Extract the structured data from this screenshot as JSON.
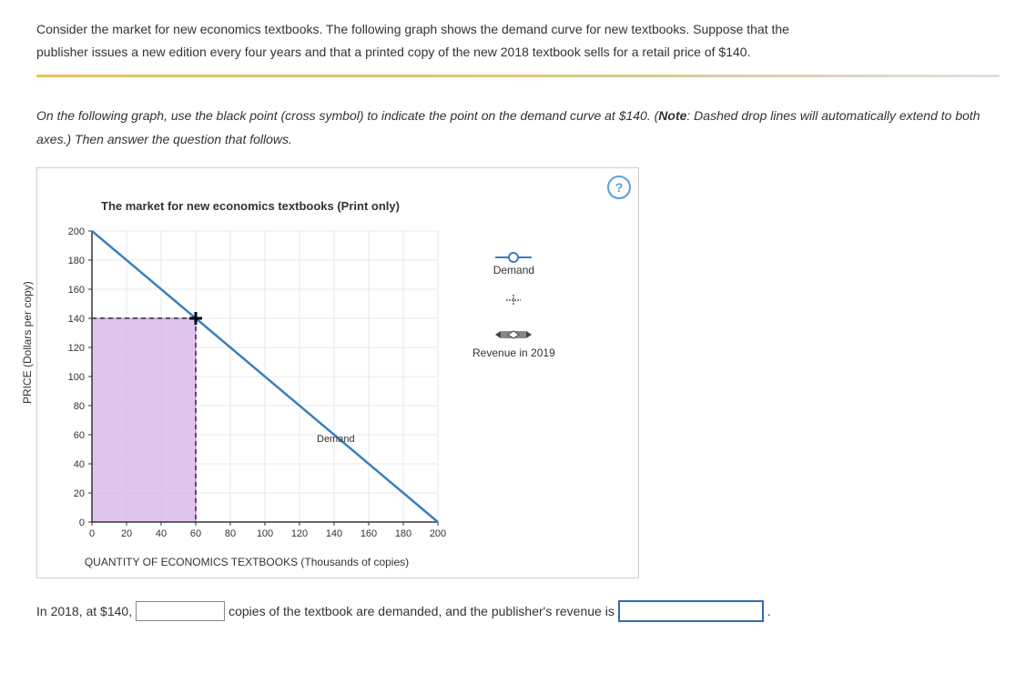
{
  "intro": {
    "line1": "Consider the market for new economics textbooks. The following graph shows the demand curve for new textbooks. Suppose that the",
    "line2": "publisher issues a new edition every four years and that a printed copy of the new 2018 textbook sells for a retail price of $140."
  },
  "instructions": {
    "pre": "On the following graph, use the black point (cross symbol) to indicate the point on the demand curve at $140. (",
    "note_label": "Note",
    "post": ": Dashed drop lines will automatically extend to both axes.) Then answer the question that follows."
  },
  "help": "?",
  "chart_title": "The market for new economics textbooks (Print only)",
  "legend": {
    "demand": "Demand",
    "revenue": "Revenue in 2019"
  },
  "answer": {
    "prefix": "In 2018, at $140,",
    "middle": "copies of the textbook are demanded, and the publisher's revenue is",
    "suffix": "."
  },
  "chart_data": {
    "type": "line",
    "title": "The market for new economics textbooks (Print only)",
    "xlabel": "QUANTITY OF ECONOMICS TEXTBOOKS (Thousands of copies)",
    "ylabel": "PRICE (Dollars per copy)",
    "xlim": [
      0,
      200
    ],
    "ylim": [
      0,
      200
    ],
    "xticks": [
      0,
      20,
      40,
      60,
      80,
      100,
      120,
      140,
      160,
      180,
      200
    ],
    "yticks": [
      0,
      20,
      40,
      60,
      80,
      100,
      120,
      140,
      160,
      180,
      200
    ],
    "series": [
      {
        "name": "Demand",
        "x": [
          0,
          200
        ],
        "y": [
          200,
          0
        ],
        "color": "#3a7fbf"
      }
    ],
    "point": {
      "x": 60,
      "y": 140,
      "symbol": "cross",
      "drop_lines": true
    },
    "shaded_region": {
      "x": [
        0,
        60
      ],
      "y": [
        0,
        140
      ],
      "color": "#d6b0e8",
      "label": "Revenue in 2019"
    },
    "demand_label": {
      "text": "Demand",
      "x": 130,
      "y": 55
    }
  }
}
